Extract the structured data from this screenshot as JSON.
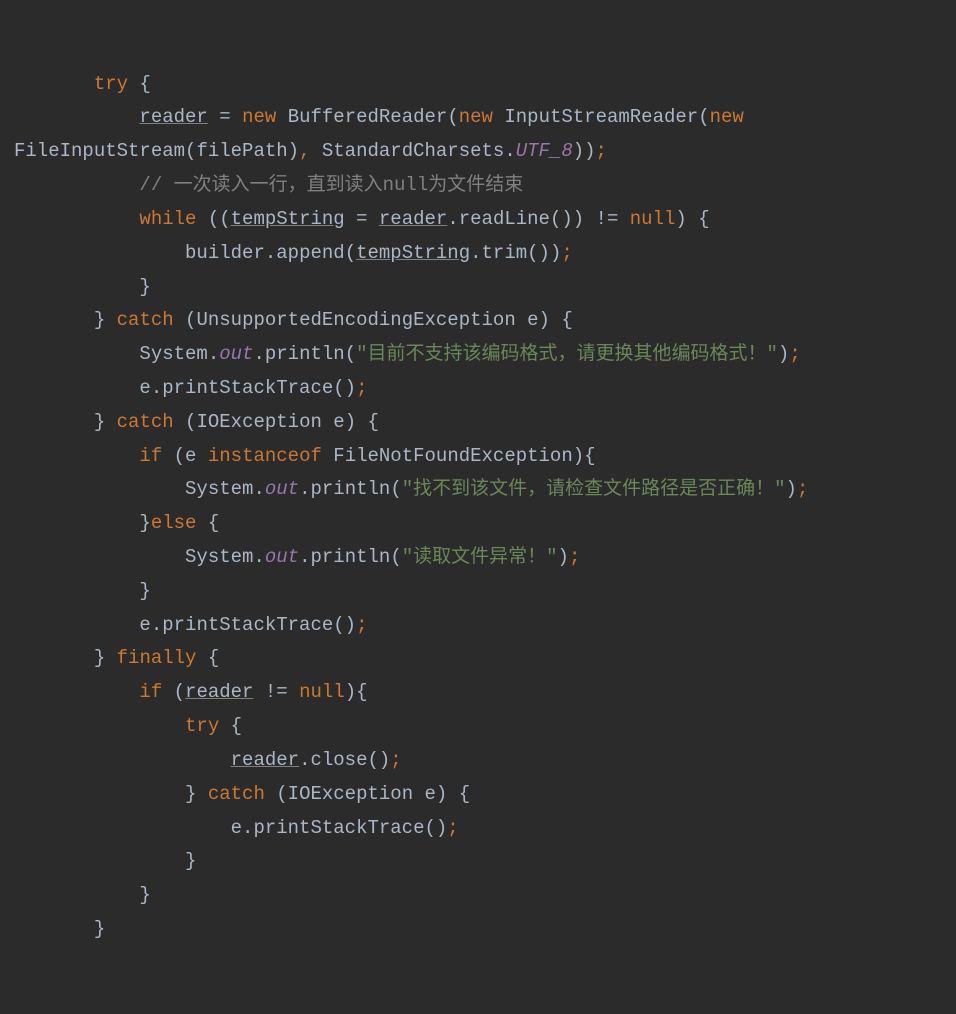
{
  "code": {
    "kw_try": "try",
    "kw_new1": "new",
    "kw_new2": "new",
    "kw_new3": "new",
    "kw_while": "while",
    "kw_null1": "null",
    "kw_catch1": "catch",
    "kw_catch2": "catch",
    "kw_catch3": "catch",
    "kw_if1": "if",
    "kw_if2": "if",
    "kw_else": "else",
    "kw_instanceof": "instanceof",
    "kw_finally": "finally",
    "kw_null2": "null",
    "kw_try2": "try",
    "var_reader": "reader",
    "var_tempString": "tempString",
    "cls_BufferedReader": "BufferedReader",
    "cls_InputStreamReader": "InputStreamReader",
    "cls_FileInputStream": "FileInputStream",
    "cls_StandardCharsets": "StandardCharsets",
    "cls_UnsupportedEncodingException": "UnsupportedEncodingException",
    "cls_IOException": "IOException",
    "cls_FileNotFoundException": "FileNotFoundException",
    "cls_System": "System",
    "field_UTF8": "UTF_8",
    "field_out": "out",
    "var_filePath": "filePath",
    "var_builder": "builder",
    "var_e": "e",
    "m_readLine": "readLine",
    "m_append": "append",
    "m_trim": "trim",
    "m_println": "println",
    "m_printStackTrace": "printStackTrace",
    "m_close": "close",
    "comment1": "// 一次读入一行，直到读入null为文件结束",
    "str1": "\"目前不支持该编码格式，请更换其他编码格式！\"",
    "str2": "\"找不到该文件，请检查文件路径是否正确！\"",
    "str3": "\"读取文件异常！\""
  }
}
